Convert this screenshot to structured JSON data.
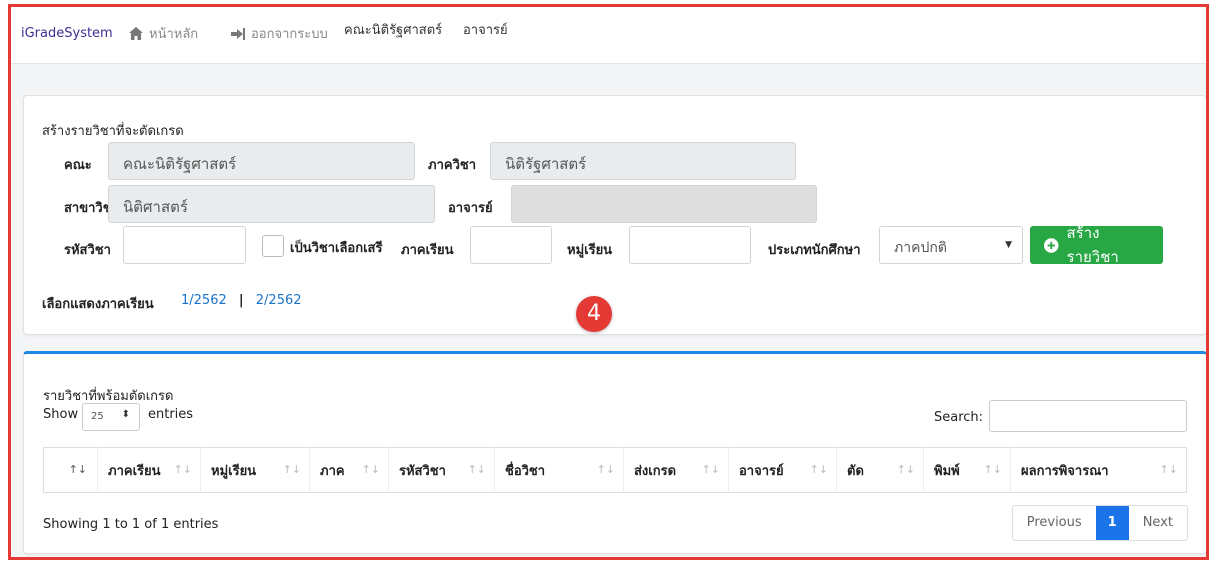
{
  "nav": {
    "brand": "iGradeSystem",
    "home": "หน้าหลัก",
    "logout": "ออกจากระบบ",
    "faculty": "คณะนิติรัฐศาสตร์",
    "role": "อาจารย์"
  },
  "create_form": {
    "title": "สร้างรายวิชาที่จะตัดเกรด",
    "faculty_label": "คณะ",
    "faculty_value": "คณะนิติรัฐศาสตร์",
    "department_label": "ภาควิชา",
    "department_value": "นิติรัฐศาสตร์",
    "major_label": "สาขาวิชา",
    "major_value": "นิติศาสตร์",
    "teacher_label": "อาจารย์",
    "teacher_value": "",
    "course_code_label": "รหัสวิชา",
    "elective_label": "เป็นวิชาเลือกเสรี",
    "semester_label": "ภาคเรียน",
    "group_label": "หมู่เรียน",
    "student_type_label": "ประเภทนักศึกษา",
    "student_type_value": "ภาคปกติ",
    "create_button": "สร้างรายวิชา",
    "semester_filter_label": "เลือกแสดงภาคเรียน",
    "semester_options": [
      "1/2562",
      "2/2562"
    ],
    "separator": "|"
  },
  "step_badge": "4",
  "ready_table": {
    "title": "รายวิชาที่พร้อมตัดเกรด",
    "show_label": "Show",
    "entries_value": "25",
    "entries_label": "entries",
    "search_label": "Search:",
    "columns": [
      "",
      "ภาคเรียน",
      "หมู่เรียน",
      "ภาค",
      "รหัสวิชา",
      "ชื่อวิชา",
      "ส่งเกรด",
      "อาจารย์",
      "ตัด",
      "พิมพ์",
      "ผลการพิจารณา"
    ],
    "info": "Showing 1 to 1 of 1 entries",
    "pager": {
      "previous": "Previous",
      "current": "1",
      "next": "Next"
    }
  },
  "colors": {
    "accent": "#1e88e5",
    "success": "#28a745",
    "brand": "#3d2f93",
    "highlight": "#e53935"
  }
}
